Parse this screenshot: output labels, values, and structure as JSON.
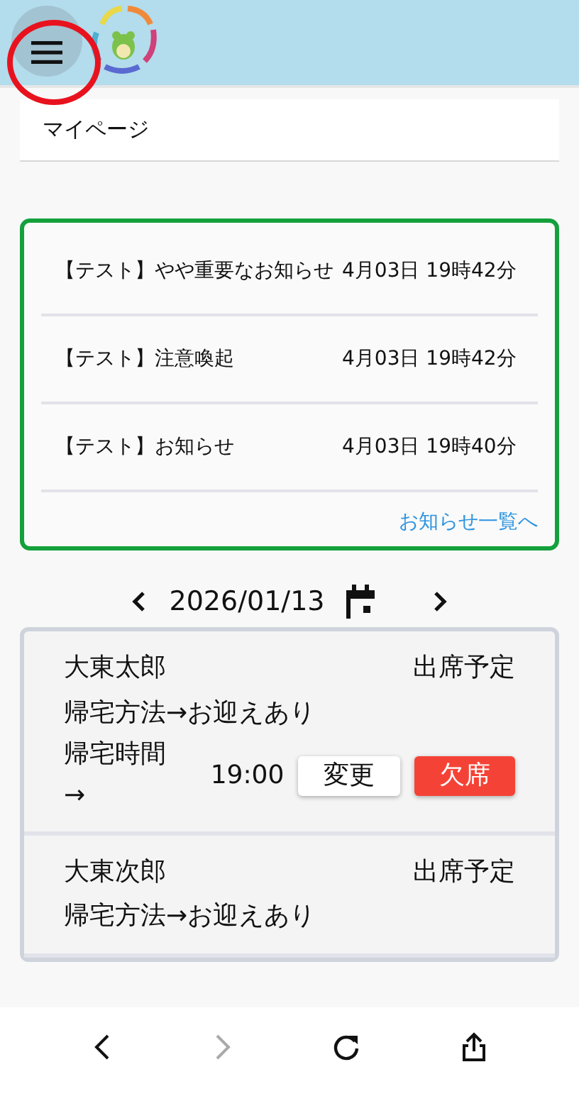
{
  "breadcrumb": "マイページ",
  "notices": [
    {
      "title": "【テスト】やや重要なお知らせ",
      "date": "4月03日 19時42分"
    },
    {
      "title": "【テスト】注意喚起",
      "date": "4月03日 19時42分"
    },
    {
      "title": "【テスト】お知らせ",
      "date": "4月03日 19時40分"
    }
  ],
  "notices_link": "お知らせ一覧へ",
  "date_nav": {
    "date": "2026/01/13"
  },
  "students": [
    {
      "name": "大東太郎",
      "status": "出席予定",
      "method": "帰宅方法→お迎えあり",
      "time_label": "帰宅時間→",
      "time": "19:00",
      "buttons": [
        {
          "label": "変更",
          "kind": "change"
        },
        {
          "label": "欠席",
          "kind": "absent"
        }
      ]
    },
    {
      "name": "大東次郎",
      "status": "出席予定",
      "method": "帰宅方法→お迎えあり"
    }
  ],
  "browser_bar": [
    {
      "kind": "back",
      "disabled": false
    },
    {
      "kind": "forward",
      "disabled": true
    },
    {
      "kind": "reload",
      "disabled": false
    },
    {
      "kind": "share",
      "disabled": false
    }
  ]
}
